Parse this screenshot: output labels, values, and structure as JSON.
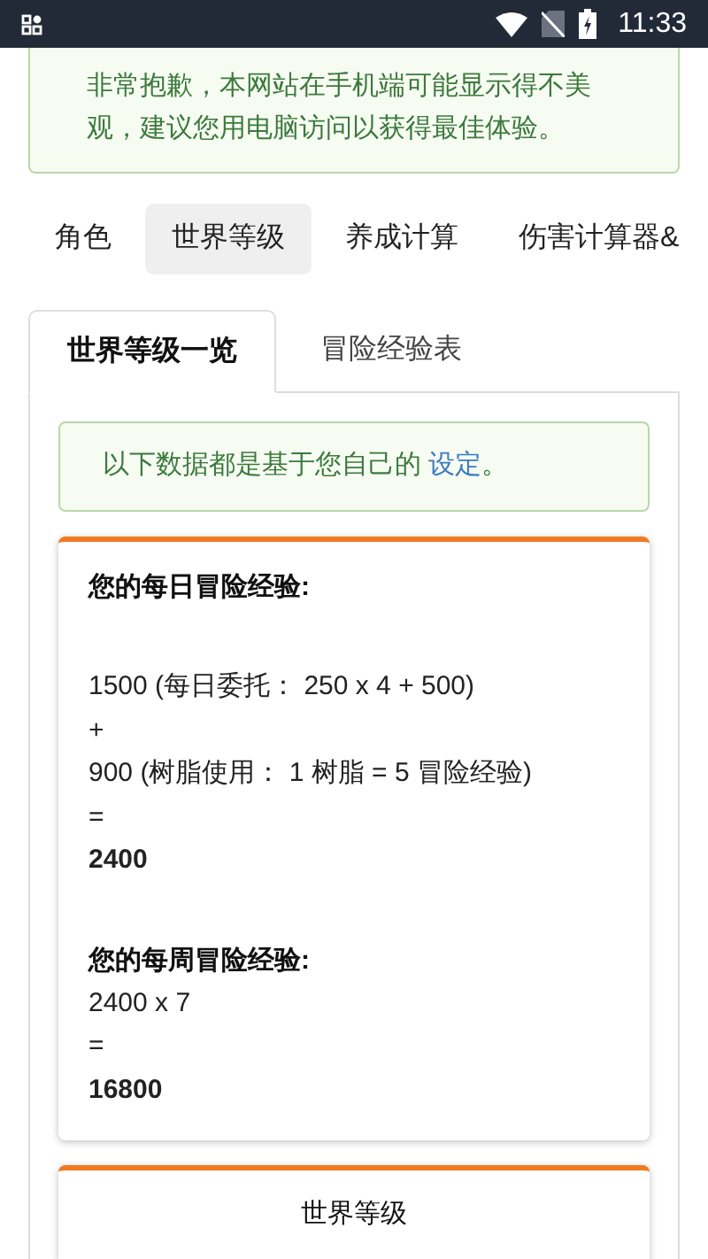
{
  "status_bar": {
    "time": "11:33"
  },
  "notice": {
    "text": "非常抱歉，本网站在手机端可能显示得不美观，建议您用电脑访问以获得最佳体验。"
  },
  "nav_tabs": [
    {
      "label": "角色",
      "selected": false
    },
    {
      "label": "世界等级",
      "selected": true
    },
    {
      "label": "养成计算",
      "selected": false
    },
    {
      "label": "伤害计算器&",
      "selected": false
    }
  ],
  "sub_tabs": [
    {
      "label": "世界等级一览",
      "selected": true
    },
    {
      "label": "冒险经验表",
      "selected": false
    }
  ],
  "info": {
    "text": "以下数据都是基于您自己的",
    "link": "设定",
    "suffix": "。"
  },
  "cards": [
    {
      "sections": [
        {
          "title": "您的每日冒险经验:",
          "lines": [
            {
              "text": "1500 (每日委托： 250 x 4 + 500)",
              "bold": false
            },
            {
              "text": "+",
              "bold": false
            },
            {
              "text": "900 (树脂使用： 1 树脂 = 5 冒险经验)",
              "bold": false
            },
            {
              "text": "=",
              "bold": false
            },
            {
              "text": "2400",
              "bold": true
            }
          ]
        },
        {
          "title": "您的每周冒险经验:",
          "lines": [
            {
              "text": "2400 x 7",
              "bold": false
            },
            {
              "text": "=",
              "bold": false
            },
            {
              "text": "16800",
              "bold": true
            }
          ]
        }
      ]
    },
    {
      "heading": "世界等级"
    }
  ]
}
